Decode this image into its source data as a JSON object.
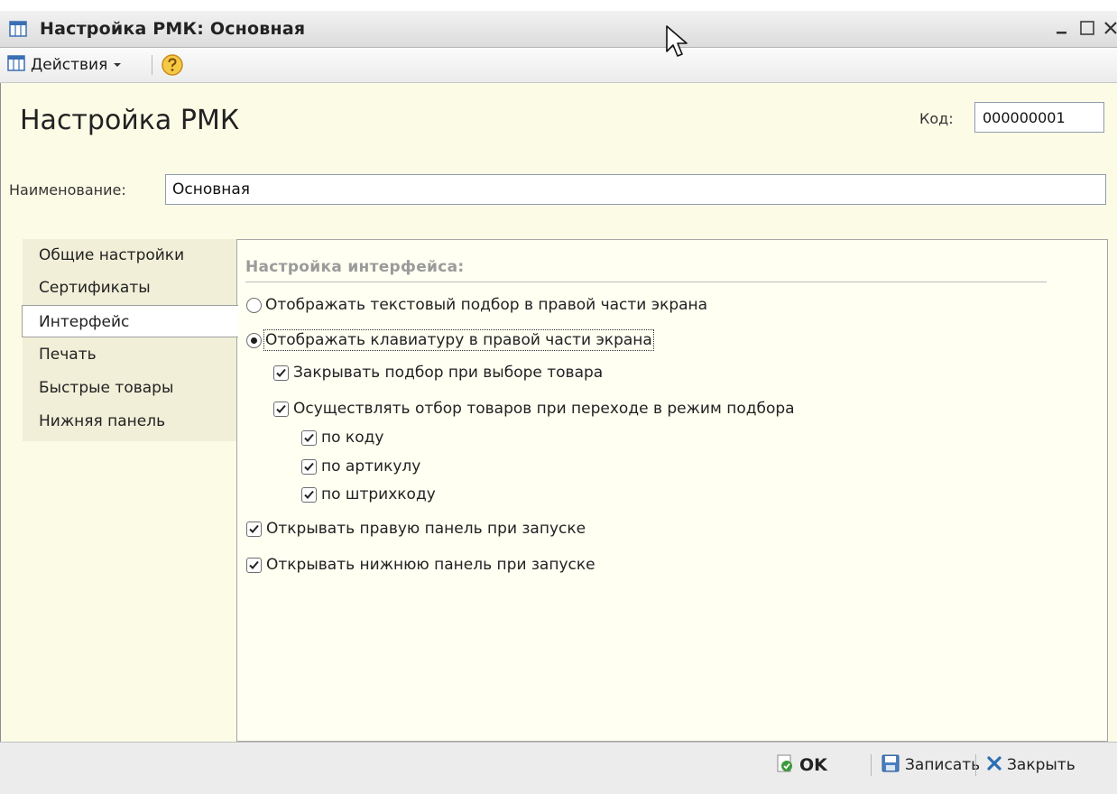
{
  "window": {
    "title": "Настройка РМК: Основная"
  },
  "toolbar": {
    "actions_label": "Действия"
  },
  "form": {
    "heading": "Настройка РМК",
    "code_label": "Код:",
    "code_value": "000000001",
    "name_label": "Наименование:",
    "name_value": "Основная"
  },
  "tabs": [
    {
      "label": "Общие настройки"
    },
    {
      "label": "Сертификаты"
    },
    {
      "label": "Интерфейс",
      "active": true
    },
    {
      "label": "Печать"
    },
    {
      "label": "Быстрые товары"
    },
    {
      "label": "Нижняя панель"
    }
  ],
  "interface_settings": {
    "section_title": "Настройка интерфейса:",
    "radio_text_selection": {
      "label": "Отображать текстовый подбор в правой части экрана",
      "selected": false
    },
    "radio_keyboard": {
      "label": "Отображать клавиатуру в правой части экрана",
      "selected": true
    },
    "close_selection": {
      "label": "Закрывать подбор при выборе товара",
      "checked": true
    },
    "filter_goods": {
      "label": "Осуществлять отбор товаров при переходе в режим подбора",
      "checked": true
    },
    "by_code": {
      "label": "по коду",
      "checked": true
    },
    "by_article": {
      "label": "по артикулу",
      "checked": true
    },
    "by_barcode": {
      "label": "по штрихкоду",
      "checked": true
    },
    "open_right_panel": {
      "label": "Открывать правую панель при запуске",
      "checked": true
    },
    "open_bottom_panel": {
      "label": "Открывать нижнюю панель при запуске",
      "checked": true
    }
  },
  "buttons": {
    "ok": "OK",
    "save": "Записать",
    "close": "Закрыть"
  },
  "icons": [
    "table-icon",
    "chevron-down-icon",
    "help-icon",
    "minimize-icon",
    "maximize-icon",
    "close-icon",
    "check-icon",
    "floppy-disk-icon",
    "cross-icon",
    "mouse-cursor-icon"
  ],
  "colors": {
    "form_background": "#fbfbe6",
    "section_title": "#9b9b9b",
    "close_icon": "#2a6fb5",
    "ok_icon": "#3c9a3c"
  }
}
